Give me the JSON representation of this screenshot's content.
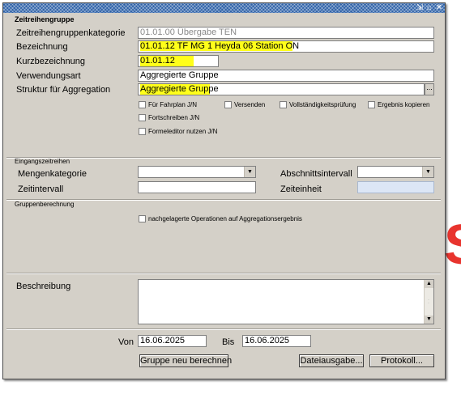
{
  "titlebar": {
    "icons": [
      "pin-icon",
      "restore-icon",
      "close-icon"
    ],
    "glyphs": [
      "⇲",
      "⌂",
      "✕"
    ]
  },
  "header": {
    "section_title": "Zeitreihengruppe"
  },
  "form": {
    "kategorie": {
      "label": "Zeitreihengruppenkategorie",
      "value": "01.01.00 Übergabe TEN"
    },
    "bezeichnung": {
      "label": "Bezeichnung",
      "value": "01.01.12 TF MG 1 Heyda 06 Station O",
      "value_tail": "N"
    },
    "kurz": {
      "label": "Kurzbezeichnung",
      "value": "01.01.12"
    },
    "verwendung": {
      "label": "Verwendungsart",
      "value": "Aggregierte Gruppe"
    },
    "struktur": {
      "label": "Struktur für Aggregation",
      "value": "Aggregierte Gruppe",
      "button": "..."
    }
  },
  "checkboxes": {
    "fahrplan": "Für Fahrplan J/N",
    "versenden": "Versenden",
    "vollstaendigkeit": "Vollständigkeitsprüfung",
    "ergebnis": "Ergebnis kopieren",
    "fortschreiben": "Fortschreiben J/N",
    "formeleditor": "Formeleditor nutzen J/N"
  },
  "eingang": {
    "section_title": "Eingangszeitreihen",
    "mengenkategorie": "Mengenkategorie",
    "abschnittsintervall": "Abschnittsintervall",
    "zeitintervall": "Zeitintervall",
    "zeiteinheit": "Zeiteinheit"
  },
  "gruppenberechnung": {
    "section_title": "Gruppenberechnung",
    "nachgelagert": "nachgelagerte Operationen auf Aggregationsergebnis"
  },
  "beschreibung": {
    "label": "Beschreibung"
  },
  "dates": {
    "von_label": "Von",
    "von": "16.06.2025",
    "bis_label": "Bis",
    "bis": "16.06.2025"
  },
  "buttons": {
    "neu_berechnen": "Gruppe neu berechnen",
    "dateiausgabe": "Dateiausgabe...",
    "protokoll": "Protokoll..."
  },
  "decoration": {
    "side_letter": "S"
  }
}
